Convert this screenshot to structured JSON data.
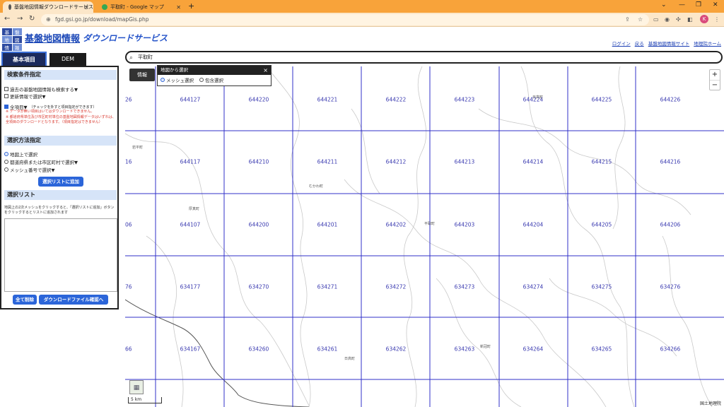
{
  "browser": {
    "tabs": [
      {
        "title": "基盤地図情報ダウンロードサービス",
        "active": true
      },
      {
        "title": "平取町 - Google マップ",
        "active": false
      }
    ],
    "url": "fgd.gsi.go.jp/download/mapGis.php",
    "profile_initial": "K"
  },
  "header": {
    "logo_chars": [
      "基",
      "盤",
      "地",
      "図",
      "情",
      "報"
    ],
    "title": "基盤地図情報",
    "subtitle": "ダウンロードサービス",
    "links": [
      "ログイン",
      "戻る",
      "基盤地図情報サイト",
      "地理院ホーム"
    ]
  },
  "left_panel": {
    "tabs": [
      "基本項目",
      "DEM"
    ],
    "search_cond": {
      "heading": "検索条件指定",
      "option_past": "過去の基盤地図情報も検索する▼",
      "option_update": "更新情報で選択▼",
      "option_all": "全項目▼",
      "option_all_hint": "（チェックを外すと項目指定ができます）",
      "note1": "※ データが無い項目はいてはダウンロードできません。",
      "note2": "※ 都道府県単位及び市区町村単位の基盤地図情報データはいずれは、全項目のダウンロードとなります。（項目指定はできません）"
    },
    "select_method": {
      "heading": "選択方法指定",
      "options": [
        "地図上で選択",
        "都道府県または市区町村で選択▼",
        "メッシュ番号で選択▼"
      ],
      "add_button": "選択リストに追加"
    },
    "select_list": {
      "heading": "選択リスト",
      "description": "地図上の2次メッシュをクリックすると、「選択リストに追加」ボタンをクリックするとリストに追加されます",
      "clear_button": "全て削除",
      "confirm_button": "ダウンロードファイル確認へ"
    }
  },
  "map": {
    "search_value": "平取町",
    "info_button": "情報",
    "popup": {
      "title": "地図から選択",
      "options": [
        "メッシュ選択",
        "包含選択"
      ]
    },
    "zoom_in": "+",
    "zoom_out": "−",
    "scale_label": "5 km",
    "credit": "国土地理院",
    "mesh_rows": [
      [
        "26",
        "644127",
        "644220",
        "644221",
        "644222",
        "644223",
        "644224",
        "644225",
        "644226"
      ],
      [
        "16",
        "644117",
        "644210",
        "644211",
        "644212",
        "644213",
        "644214",
        "644215",
        "644216"
      ],
      [
        "06",
        "644107",
        "644200",
        "644201",
        "644202",
        "644203",
        "644204",
        "644205",
        "644206"
      ],
      [
        "76",
        "634177",
        "634270",
        "634271",
        "634272",
        "634273",
        "634274",
        "634275",
        "634276"
      ],
      [
        "66",
        "634167",
        "634260",
        "634261",
        "634262",
        "634263",
        "634264",
        "634265",
        "634266"
      ]
    ],
    "place_names": [
      "岩平町",
      "むかわ町",
      "厚真町",
      "平取町",
      "日高町",
      "新冠町",
      "日高町"
    ]
  }
}
